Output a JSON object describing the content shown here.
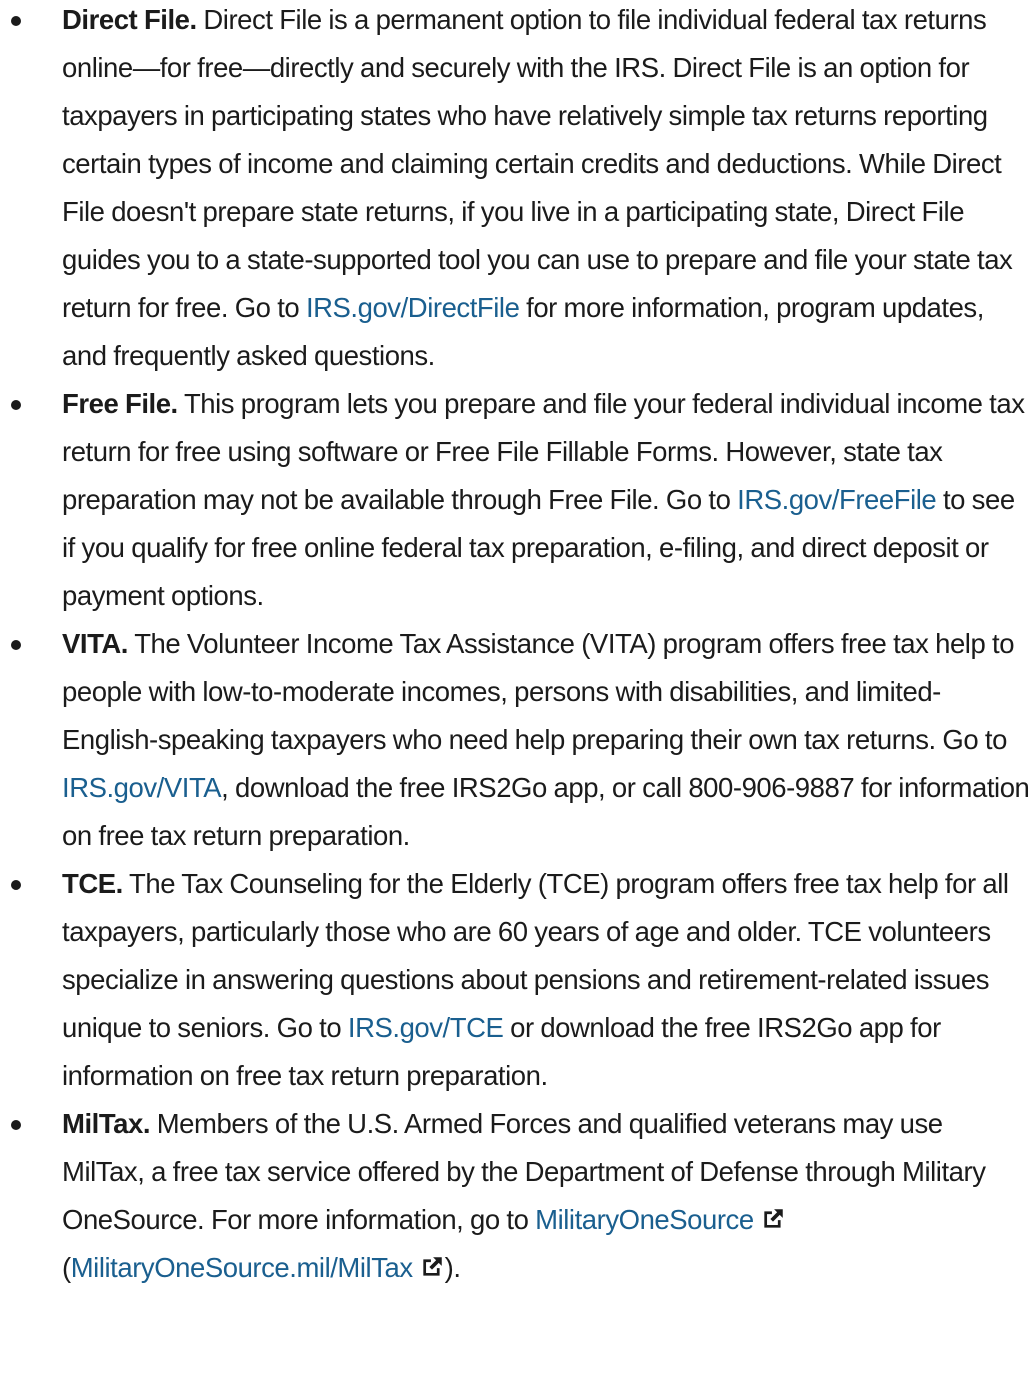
{
  "items": [
    {
      "term": "Direct File.",
      "text_before": " Direct File is a permanent option to file individual federal tax returns online—for free—directly and securely with the IRS. Direct File is an option for taxpayers in participating states who have relatively simple tax returns reporting certain types of income and claiming certain credits and deductions. While Direct File doesn't prepare state returns, if you live in a participating state, Direct File guides you to a state-supported tool you can use to prepare and file your state tax return for free. Go to ",
      "link": "IRS.gov/DirectFile",
      "text_after": " for more information, program updates, and frequently asked questions."
    },
    {
      "term": "Free File.",
      "text_before": " This program lets you prepare and file your federal individual income tax return for free using software or Free File Fillable Forms. However, state tax preparation may not be available through Free File. Go to ",
      "link": "IRS.gov/FreeFile",
      "text_after": " to see if you qualify for free online federal tax preparation, e-filing, and direct deposit or payment options."
    },
    {
      "term": "VITA.",
      "text_before": " The Volunteer Income Tax Assistance (VITA) program offers free tax help to people with low-to-moderate incomes, persons with disabilities, and limited-English-speaking taxpayers who need help preparing their own tax returns. Go to ",
      "link": "IRS.gov/VITA",
      "text_after": ", download the free IRS2Go app, or call 800-906-9887 for information on free tax return preparation."
    },
    {
      "term": "TCE.",
      "text_before": " The Tax Counseling for the Elderly (TCE) program offers free tax help for all taxpayers, particularly those who are 60 years of age and older. TCE volunteers specialize in answering questions about pensions and retirement-related issues unique to seniors. Go to ",
      "link": "IRS.gov/TCE",
      "text_after": " or download the free IRS2Go app for information on free tax return preparation."
    },
    {
      "term": "MilTax.",
      "text_before": " Members of the U.S. Armed Forces and qualified veterans may use MilTax, a free tax service offered by the Department of Defense through Military OneSource. For more information, go to ",
      "link": "MilitaryOneSource",
      "text_middle": " (",
      "link2": "MilitaryOneSource.mil/MilTax",
      "text_after": ")."
    }
  ],
  "colors": {
    "text": "#1b1b1b",
    "link": "#1a5f8f"
  },
  "icons": {
    "external_link": "external-link-icon"
  }
}
